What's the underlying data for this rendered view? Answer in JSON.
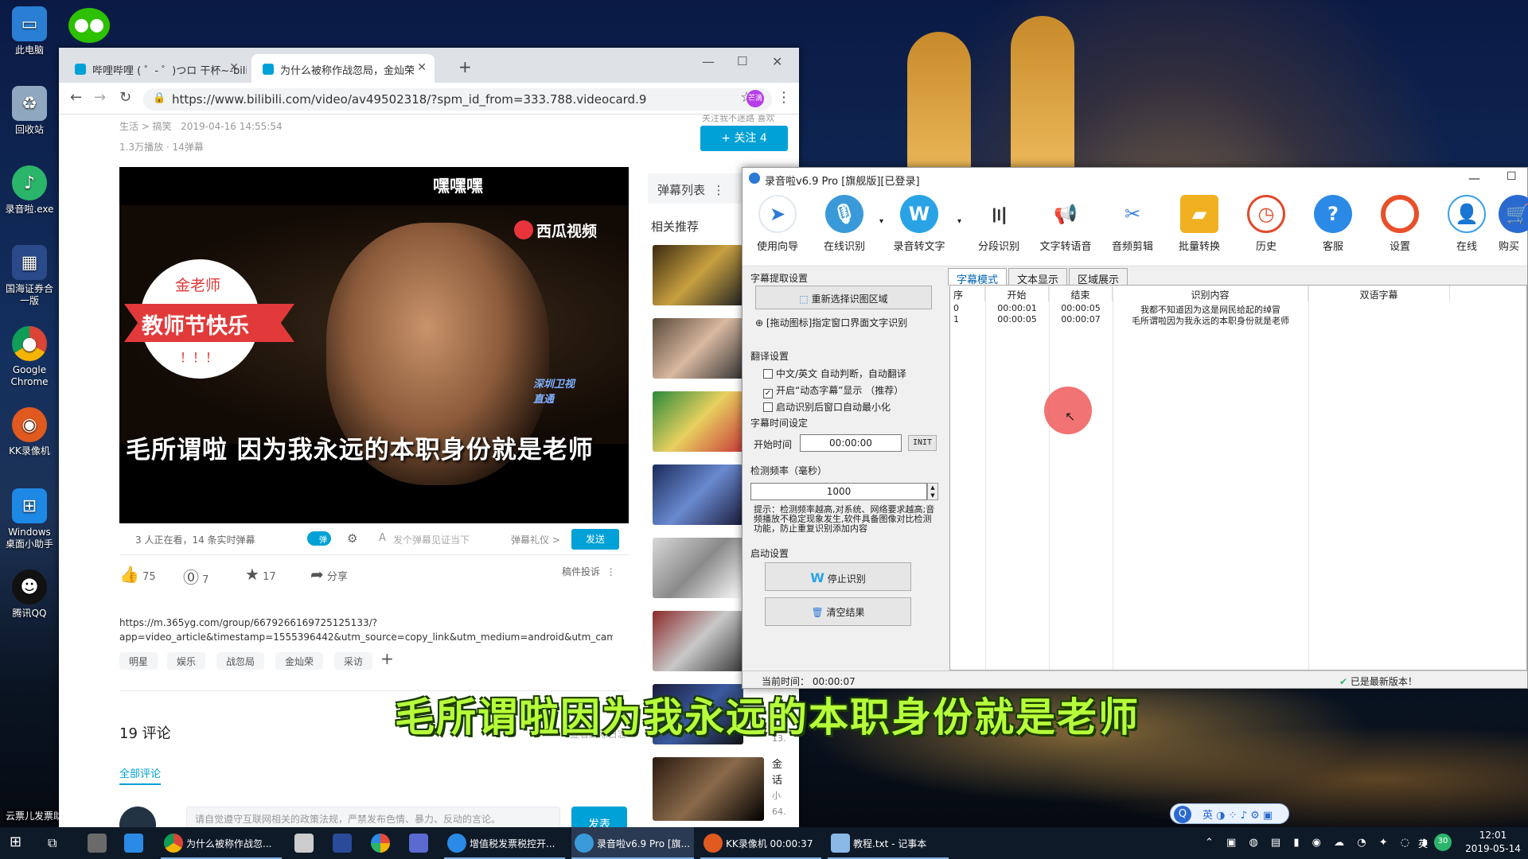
{
  "desktop": {
    "icons": [
      {
        "label": "此电脑"
      },
      {
        "label": "回收站"
      },
      {
        "label": "录音啦.exe"
      },
      {
        "label": "国海证券合一版"
      },
      {
        "label": "Google Chrome"
      },
      {
        "label": "KK录像机"
      },
      {
        "label": "Windows桌面小助手"
      },
      {
        "label": "腾讯QQ"
      }
    ],
    "bottom_left_label": "云票儿发票助"
  },
  "browser": {
    "tabs": [
      {
        "title": "哔哩哔哩 ( ゜- ゜)つロ 干杯~-bili"
      },
      {
        "title": "为什么被称作战忽局，金灿荣"
      }
    ],
    "url": "https://www.bilibili.com/video/av49502318/?spm_id_from=333.788.videocard.9",
    "avatar_text": "芒滴",
    "page": {
      "breadcrumb": "生活 > 搞笑",
      "date": "2019-04-16 14:55:54",
      "stats": "1.3万播放 · 14弹幕",
      "follow_label": "+ 关注 4",
      "follow_note": "关注我不迷路 喜欢",
      "video_top_text": "嘿嘿嘿",
      "watermark": "西瓜视频",
      "badge_top": "金老师",
      "badge_mid": "教师节快乐",
      "badge_bottom": "！！！",
      "channel_logo": "深圳卫视 直通",
      "video_subtitle": "毛所谓啦 因为我永远的本职身份就是老师",
      "watching": "3 人正在看，14 条实时弹幕",
      "danmaku_placeholder": "发个弹幕见证当下",
      "danmaku_etiquette": "弹幕礼仪 >",
      "send": "发送",
      "toggle_label": "弹",
      "likes": "75",
      "coins": "7",
      "favs": "17",
      "share": "分享",
      "report": "稿件投诉",
      "desc_line1": "https://m.365yg.com/group/6679266169725125133/?",
      "desc_line2": "app=video_article&timestamp=1555396442&utm_source=copy_link&utm_medium=android&utm_campaign=",
      "tags": [
        "明星",
        "娱乐",
        "战忽局",
        "金灿荣",
        "采访"
      ],
      "comments_title": "19  评论",
      "comment_log": "查看删除日志",
      "all_comments": "全部评论",
      "comment_placeholder": "请自觉遵守互联网相关的政策法规，严禁发布色情、暴力、反动的言论。",
      "comment_send": "发表",
      "danmaku_list": "弹幕列表",
      "related": "相关推荐",
      "side_texts": [
        "13.",
        "金",
        "话",
        "小",
        "64."
      ]
    }
  },
  "app": {
    "title": "录音啦v6.9 Pro [旗舰版][已登录]",
    "tools": [
      {
        "label": "使用向导",
        "icon": "navigate-icon",
        "color": "#2b7ad6"
      },
      {
        "label": "在线识别",
        "icon": "microphone-icon",
        "color": "#3a9ad9"
      },
      {
        "label": "录音转文字",
        "icon": "word-icon",
        "color": "#29a3e6"
      },
      {
        "label": "分段识别",
        "icon": "waveform-icon",
        "color": "#333333"
      },
      {
        "label": "文字转语音",
        "icon": "megaphone-icon",
        "color": "#e0453a"
      },
      {
        "label": "音频剪辑",
        "icon": "scissors-icon",
        "color": "#3a7fd6"
      },
      {
        "label": "批量转换",
        "icon": "folder-icon",
        "color": "#f0b020"
      },
      {
        "label": "历史",
        "icon": "clock-icon",
        "color": "#e04a2a"
      },
      {
        "label": "客服",
        "icon": "help-icon",
        "color": "#2b8ae6"
      },
      {
        "label": "设置",
        "icon": "lifebuoy-icon",
        "color": "#e8502a"
      },
      {
        "label": "在线",
        "icon": "user-icon",
        "color": "#3aa0e6"
      },
      {
        "label": "购买",
        "icon": "cart-icon",
        "color": "#2a6ad0"
      }
    ],
    "sections": {
      "subtitle_extract": "字幕提取设置",
      "reselect": "重新选择识图区域",
      "drag_icon": "[拖动图标]指定窗口界面文字识别",
      "translate": "翻译设置",
      "cb1": "中文/英文 自动判断，自动翻译",
      "cb2": "开启“动态字幕”显示   （推荐）",
      "cb3": "启动识别后窗口自动最小化",
      "time_settings": "字幕时间设定",
      "start_time_label": "开始时间",
      "start_time": "00:00:00",
      "init": "INIT",
      "freq_label": "检测频率（毫秒）",
      "freq": "1000",
      "tip": "提示：检测频率越高,对系统、网络要求越高;音频播放不稳定现象发生,软件具备图像对比检测功能，防止重复识别添加内容",
      "start_settings": "启动设置",
      "stop": "停止识别",
      "clear": "清空结果"
    },
    "tabs": [
      "字幕模式",
      "文本显示",
      "区域展示"
    ],
    "columns": [
      "序",
      "开始",
      "结束",
      "识别内容",
      "双语字幕"
    ],
    "rows": [
      [
        "0",
        "00:00:01",
        "00:00:05",
        "我都不知道因为这是网民给起的绰冒",
        ""
      ],
      [
        "1",
        "00:00:05",
        "00:00:07",
        "毛所谓啦因为我永远的本职身份就是老师",
        ""
      ]
    ],
    "status_time": "当前时间：  00:00:07",
    "status_version": "已是最新版本！"
  },
  "overlay_subtitle": "毛所谓啦因为我永远的本职身份就是老师",
  "taskbar": {
    "items": [
      {
        "label": "为什么被称作战忽..."
      },
      {
        "label": "增值税发票税控开..."
      },
      {
        "label": "录音啦v6.9 Pro [旗..."
      },
      {
        "label": "KK录像机 00:00:37"
      },
      {
        "label": "教程.txt - 记事本"
      }
    ],
    "ime": "英",
    "tray_badge": "30",
    "time": "12:01",
    "date": "2019-05-14"
  }
}
